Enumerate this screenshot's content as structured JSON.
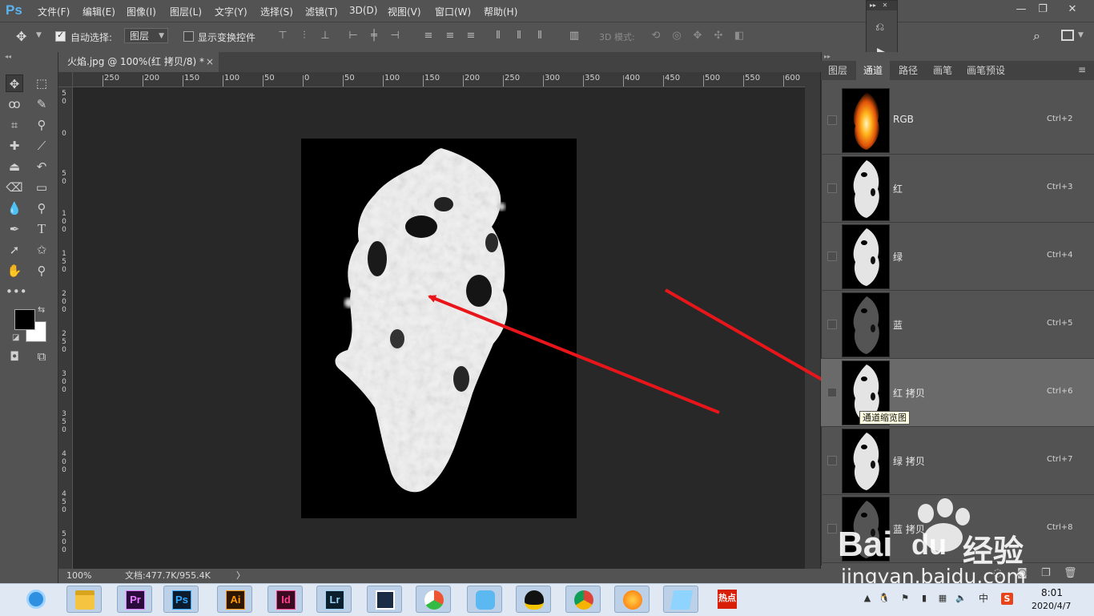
{
  "app": {
    "logo": "Ps",
    "menus": [
      "文件(F)",
      "编辑(E)",
      "图像(I)",
      "图层(L)",
      "文字(Y)",
      "选择(S)",
      "滤镜(T)",
      "3D(D)",
      "视图(V)",
      "窗口(W)",
      "帮助(H)"
    ],
    "window_controls": [
      "—",
      "❐",
      "✕"
    ]
  },
  "options_bar": {
    "auto_select_label": "自动选择:",
    "auto_select_checked": true,
    "layer_select_value": "图层",
    "show_transform_label": "显示变换控件",
    "show_transform_checked": false,
    "mode_3d_label": "3D 模式:"
  },
  "document": {
    "tab_title": "火焰.jpg @ 100%(红 拷贝/8) *",
    "tab_close": "×",
    "zoom": "100%",
    "doc_info": "文档:477.7K/955.4K",
    "doc_info_arrow": "〉"
  },
  "ruler": {
    "top_labels": [
      "250",
      "200",
      "150",
      "100",
      "50",
      "0",
      "50",
      "100",
      "150",
      "200",
      "250",
      "300",
      "350",
      "400",
      "450",
      "500",
      "550",
      "600"
    ],
    "left_labels": [
      "5\n0",
      "0",
      "5\n0",
      "1\n0\n0",
      "1\n5\n0",
      "2\n0\n0",
      "2\n5\n0",
      "3\n0\n0",
      "3\n5\n0",
      "4\n0\n0",
      "4\n5\n0",
      "5\n0\n0",
      "5\n5\n0"
    ]
  },
  "panel": {
    "tabs": [
      "图层",
      "通道",
      "路径",
      "画笔",
      "画笔预设"
    ],
    "active_tab": "通道",
    "channels": [
      {
        "name": "RGB",
        "shortcut": "Ctrl+2",
        "selected": false,
        "thumb": "color"
      },
      {
        "name": "红",
        "shortcut": "Ctrl+3",
        "selected": false,
        "thumb": "gray"
      },
      {
        "name": "绿",
        "shortcut": "Ctrl+4",
        "selected": false,
        "thumb": "gray"
      },
      {
        "name": "蓝",
        "shortcut": "Ctrl+5",
        "selected": false,
        "thumb": "dark"
      },
      {
        "name": "红 拷贝",
        "shortcut": "Ctrl+6",
        "selected": true,
        "thumb": "gray"
      },
      {
        "name": "绿 拷贝",
        "shortcut": "Ctrl+7",
        "selected": false,
        "thumb": "gray"
      },
      {
        "name": "蓝 拷贝",
        "shortcut": "Ctrl+8",
        "selected": false,
        "thumb": "dark"
      }
    ],
    "tooltip": "通道缩览图"
  },
  "watermark": {
    "brand": "Bai",
    "brand2": "du",
    "brand_cn": "经验",
    "url": "jingyan.baidu.com"
  },
  "taskbar": {
    "apps": [
      {
        "name": "ie-browser-icon",
        "label": ""
      },
      {
        "name": "file-explorer-icon",
        "label": ""
      },
      {
        "name": "premiere-icon",
        "label": "Pr"
      },
      {
        "name": "photoshop-icon",
        "label": "Ps"
      },
      {
        "name": "illustrator-icon",
        "label": "Ai"
      },
      {
        "name": "indesign-icon",
        "label": "Id"
      },
      {
        "name": "lightroom-icon",
        "label": "Lr"
      },
      {
        "name": "video-editor-icon",
        "label": ""
      },
      {
        "name": "umbrella-app-icon",
        "label": ""
      },
      {
        "name": "bird-app-icon",
        "label": ""
      },
      {
        "name": "qq-icon",
        "label": ""
      },
      {
        "name": "chrome-icon",
        "label": ""
      },
      {
        "name": "firefox-like-icon",
        "label": ""
      },
      {
        "name": "notes-app-icon",
        "label": ""
      },
      {
        "name": "news-app-icon",
        "label": "热点"
      }
    ],
    "ime": "中",
    "time": "8:01",
    "date": "2020/4/7"
  },
  "colors": {
    "ps_blue": "#31a8ff",
    "panel_bg": "#535353",
    "arrow_red": "#e8161b"
  }
}
